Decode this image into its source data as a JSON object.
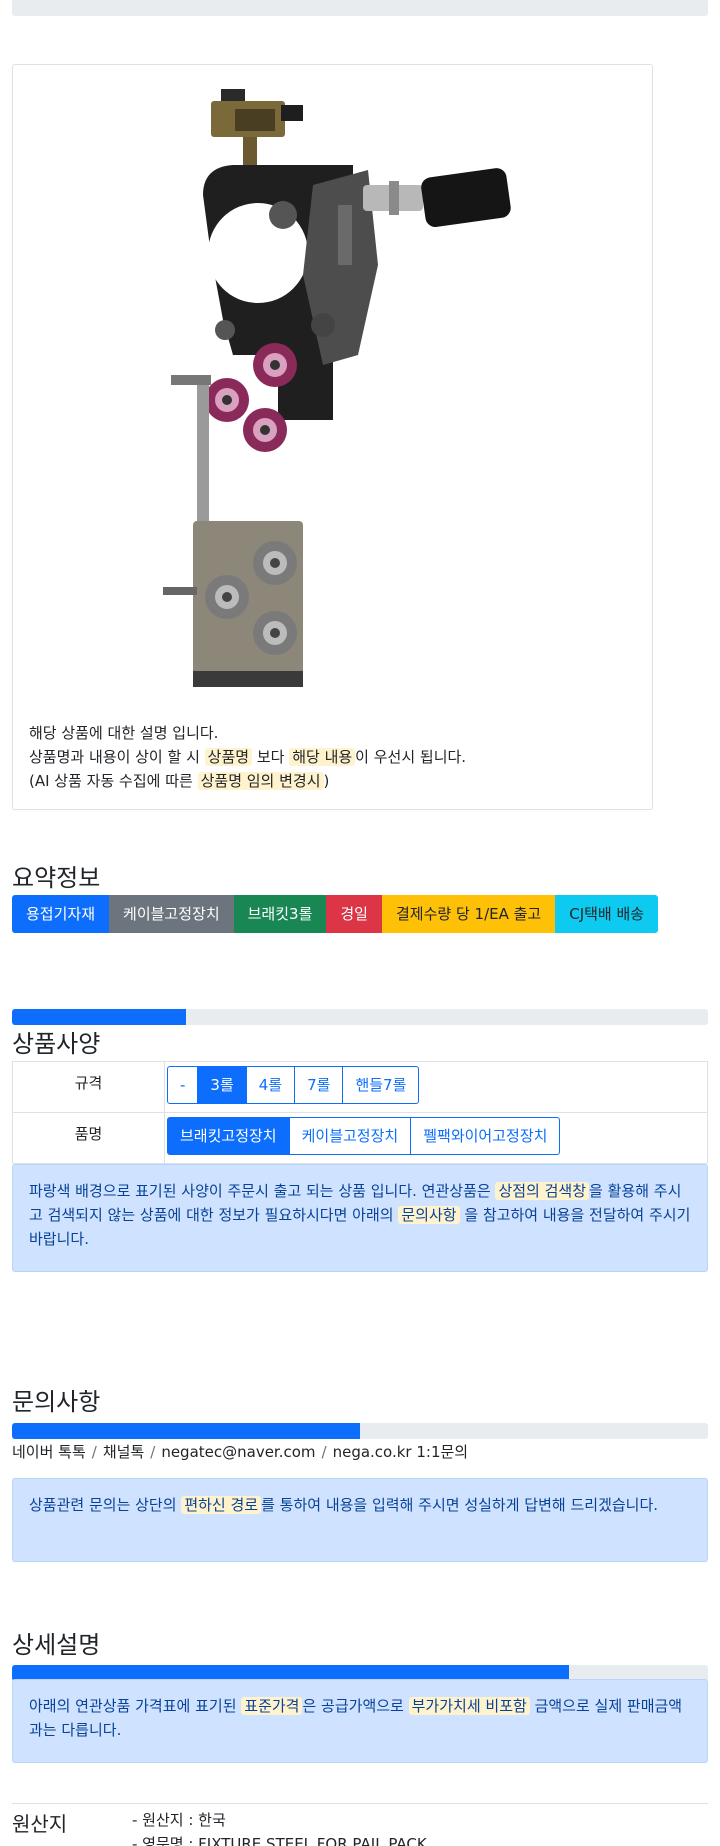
{
  "product": {
    "image_alt": "welding wire feeder fixture",
    "description": {
      "line1": "해당 상품에 대한 설명 입니다.",
      "line2_pre": "상품명과 내용이 상이 할 시 ",
      "line2_hl1": "상품명",
      "line2_mid": " 보다 ",
      "line2_hl2": "해당 내용",
      "line2_post": "이 우선시 됩니다.",
      "line3_pre": "(AI 상품 자동 수집에 따른 ",
      "line3_hl": "상품명 임의 변경시",
      "line3_post": ")"
    }
  },
  "summary": {
    "title": "요약정보",
    "badges": [
      "용접기자재",
      "케이블고정장치",
      "브래킷3롤",
      "경일",
      "결제수량 당 1/EA 출고",
      "CJ택배 배송"
    ]
  },
  "spec": {
    "title": "상품사양",
    "progress": 0.25,
    "rows": [
      {
        "label": "규격",
        "options": [
          "-",
          "3롤",
          "4롤",
          "7롤",
          "핸들7롤"
        ],
        "selected": 1
      },
      {
        "label": "품명",
        "options": [
          "브래킷고정장치",
          "케이블고정장치",
          "펠팩와이어고정장치"
        ],
        "selected": 0
      }
    ],
    "notice": {
      "pre": "파랑색 배경으로 표기된 사양이 주문시 출고 되는 상품 입니다. 연관상품은 ",
      "hl1": "상점의 검색창",
      "mid": "을 활용해 주시고 검색되지 않는 상품에 대한 정보가 필요하시다면 아래의 ",
      "hl2": "문의사항",
      "post": " 을 참고하여 내용을 전달하여 주시기 바랍니다."
    }
  },
  "inquiry": {
    "title": "문의사항",
    "progress": 0.5,
    "links": [
      "네이버 톡톡",
      "채널톡",
      "negatec@naver.com",
      "nega.co.kr 1:1문의"
    ],
    "notice": {
      "pre": "상품관련 문의는 상단의 ",
      "hl": "편하신 경로",
      "post": "를 통하여 내용을 입력해 주시면 성실하게 답변해 드리겠습니다."
    }
  },
  "detail": {
    "title": "상세설명",
    "progress": 0.8,
    "notice": {
      "pre": "아래의 연관상품 가격표에 표기된 ",
      "hl1": "표준가격",
      "mid": "은 공급가액으로 ",
      "hl2": "부가가치세 비포함",
      "post": " 금액으로 실제 판매금액과는 다릅니다."
    }
  },
  "origin": {
    "label": "원산지",
    "lines": [
      "- 원산지 : 한국",
      "- 영문명 : FIXTURE STEEL FOR PAIL PACK"
    ]
  },
  "colors": {
    "primary": "#0d6efd",
    "highlight": "#fff3cd",
    "alert_bg": "#cfe2ff"
  }
}
